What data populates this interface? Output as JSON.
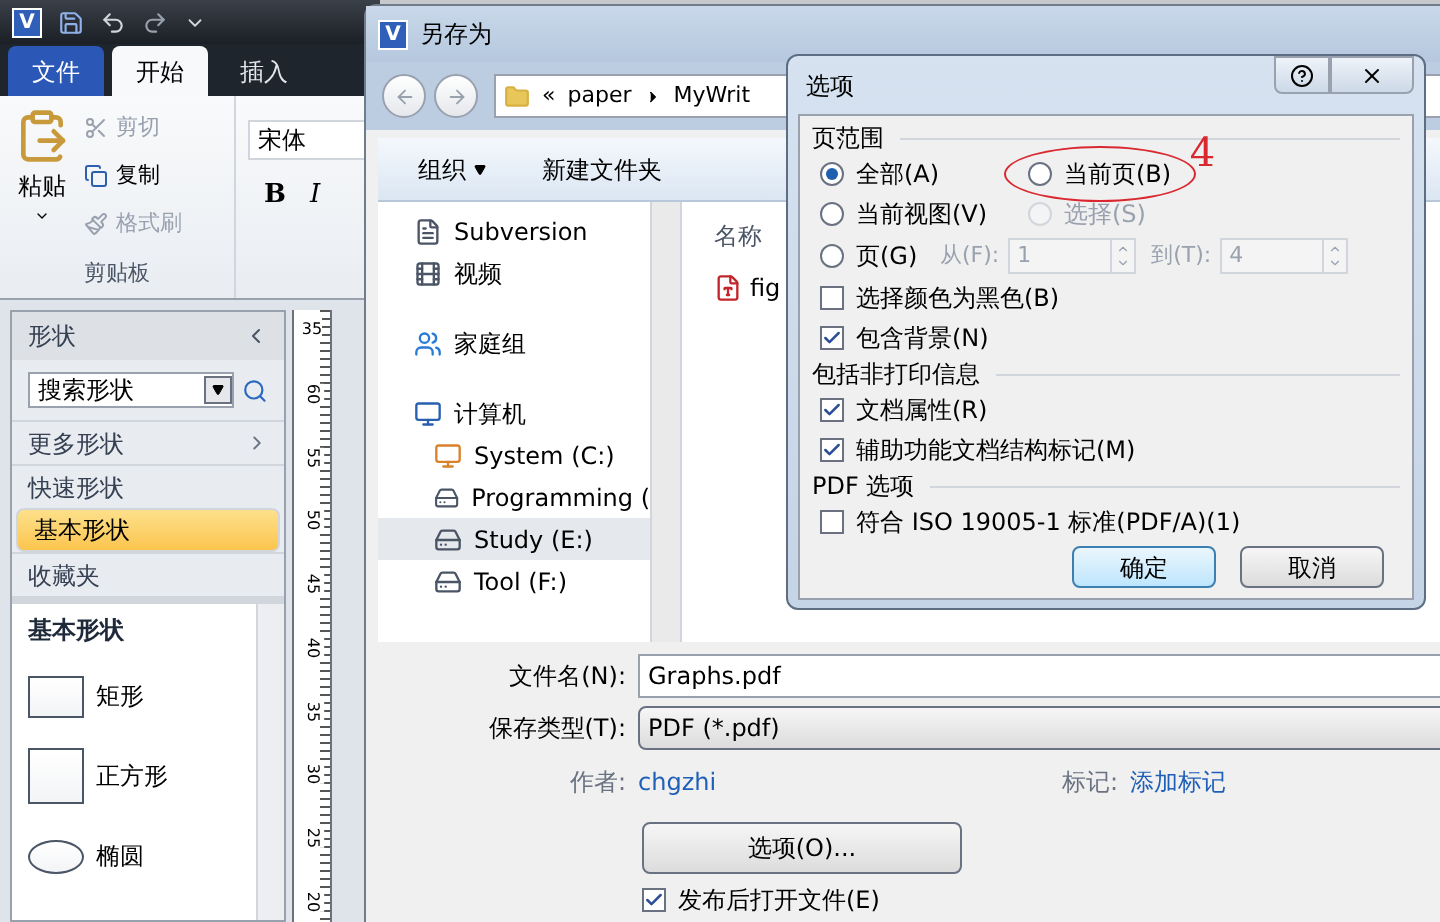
{
  "app": {
    "logo": "V",
    "tabs": [
      {
        "label": "文件",
        "kind": "file",
        "selected": false
      },
      {
        "label": "开始",
        "kind": "tab",
        "selected": true
      },
      {
        "label": "插入",
        "kind": "tab",
        "selected": false
      }
    ],
    "clipboard": {
      "paste": "粘贴",
      "items": [
        {
          "label": "剪切",
          "kind": "cut",
          "disabled": true
        },
        {
          "label": "复制",
          "kind": "copy",
          "disabled": false
        },
        {
          "label": "格式刷",
          "kind": "brush",
          "disabled": true
        }
      ],
      "group_label": "剪贴板"
    },
    "font": {
      "value": "宋体",
      "bold": "B",
      "italic": "I"
    },
    "shapes_panel": {
      "title": "形状",
      "search": {
        "placeholder": "搜索形状"
      },
      "menu": [
        {
          "label": "更多形状",
          "kind": "submenu",
          "selected": false
        },
        {
          "label": "快速形状",
          "kind": "item",
          "selected": false
        },
        {
          "label": "基本形状",
          "kind": "item",
          "selected": true
        },
        {
          "label": "收藏夹",
          "kind": "item",
          "selected": false
        }
      ],
      "stencil": {
        "title": "基本形状",
        "shapes": [
          {
            "label": "矩形",
            "kind": "rect"
          },
          {
            "label": "正方形",
            "kind": "square"
          },
          {
            "label": "椭圆",
            "kind": "ellipse"
          }
        ]
      }
    },
    "ruler": {
      "top_label": "35",
      "labels": [
        "60",
        "55",
        "50",
        "45",
        "40",
        "35",
        "30",
        "25",
        "20"
      ]
    }
  },
  "save_dialog": {
    "logo": "V",
    "title": "另存为",
    "breadcrumb": [
      "«",
      "paper",
      "MyWrit"
    ],
    "toolbar": [
      {
        "label": "组织",
        "kind": "menu"
      },
      {
        "label": "新建文件夹",
        "kind": "button"
      }
    ],
    "nav": [
      {
        "label": "Subversion",
        "kind": "doc",
        "selected": false
      },
      {
        "label": "视频",
        "kind": "video",
        "selected": false
      },
      {
        "label": "家庭组",
        "kind": "homegroup",
        "selected": false
      },
      {
        "label": "计算机",
        "kind": "computer",
        "selected": false,
        "children": [
          {
            "label": "System (C:)",
            "kind": "system",
            "selected": false
          },
          {
            "label": "Programming (",
            "kind": "drive",
            "selected": false
          },
          {
            "label": "Study (E:)",
            "kind": "drive",
            "selected": true
          },
          {
            "label": "Tool (F:)",
            "kind": "drive",
            "selected": false
          }
        ]
      }
    ],
    "files": {
      "column": "名称",
      "items": [
        "fig"
      ]
    },
    "filename": {
      "label": "文件名(N):",
      "value": "Graphs.pdf"
    },
    "filetype": {
      "label": "保存类型(T):",
      "value": "PDF (*.pdf)"
    },
    "author": {
      "label": "作者:",
      "value": "chgzhi"
    },
    "tags": {
      "label": "标记:",
      "value": "添加标记"
    },
    "options_button": "选项(O)...",
    "open_after": {
      "label": "发布后打开文件(E)",
      "checked": true
    }
  },
  "options_dialog": {
    "title": "选项",
    "page_range": {
      "title": "页范围",
      "radios": [
        {
          "label": "全部(A)",
          "selected": true,
          "disabled": false
        },
        {
          "label": "当前页(B)",
          "selected": false,
          "disabled": false
        },
        {
          "label": "当前视图(V)",
          "selected": false,
          "disabled": false
        },
        {
          "label": "选择(S)",
          "selected": false,
          "disabled": true
        },
        {
          "label": "页(G)",
          "selected": false,
          "disabled": false
        }
      ],
      "from": {
        "label": "从(F):",
        "value": "1",
        "disabled": true
      },
      "to": {
        "label": "到(T):",
        "value": "4",
        "disabled": true
      },
      "checks": [
        {
          "label": "选择颜色为黑色(B)",
          "checked": false
        },
        {
          "label": "包含背景(N)",
          "checked": true
        }
      ]
    },
    "non_print": {
      "title": "包括非打印信息",
      "checks": [
        {
          "label": "文档属性(R)",
          "checked": true
        },
        {
          "label": "辅助功能文档结构标记(M)",
          "checked": true
        }
      ]
    },
    "pdf": {
      "title": "PDF 选项",
      "checks": [
        {
          "label": "符合 ISO 19005-1 标准(PDF/A)(1)",
          "checked": false
        }
      ]
    },
    "ok": "确定",
    "cancel": "取消",
    "annotation": "4"
  }
}
